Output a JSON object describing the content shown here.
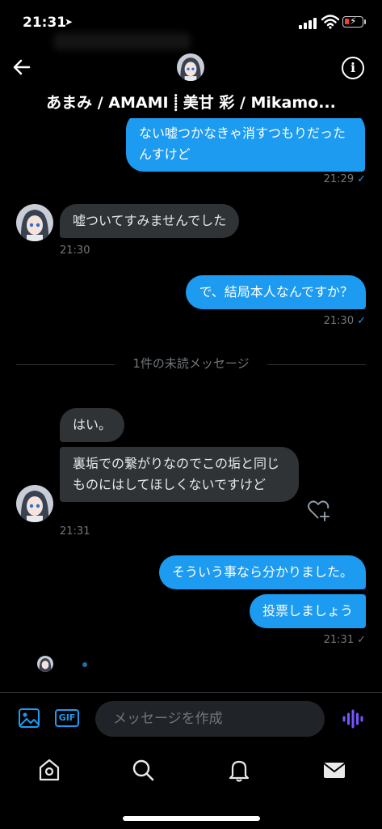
{
  "status_bar": {
    "time": "21:31"
  },
  "header": {
    "name": "あまみ / AMAMI ⸽ 美甘 彩 / Mikamo..."
  },
  "messages": {
    "m1": {
      "text": "ない嘘つかなきゃ消すつもりだったんすけど",
      "time": "21:29"
    },
    "m2": {
      "text": "嘘ついてすみませんでした",
      "time": "21:30"
    },
    "m3": {
      "text": "で、結局本人なんですか？",
      "time": "21:30"
    },
    "m4": {
      "text": "はい。"
    },
    "m5": {
      "text": "裏垢での繋がりなのでこの垢と同じものにはしてほしくないですけど",
      "time": "21:31"
    },
    "m6": {
      "text": "そういう事なら分かりました。"
    },
    "m7": {
      "text": "投票しましょう",
      "time": "21:31"
    }
  },
  "divider": {
    "text": "1件の未読メッセージ"
  },
  "composer": {
    "placeholder": "メッセージを作成",
    "gif_label": "GIF"
  },
  "icons": {
    "back": "arrow-left-icon",
    "info": "info-icon",
    "media": "image-icon",
    "voice": "voice-wave-icon",
    "home": "home-icon",
    "search": "search-icon",
    "notifications": "bell-icon",
    "messages": "mail-icon",
    "heart": "heart-plus-icon"
  },
  "colors": {
    "accent": "#1d9bf0",
    "incoming_bubble": "#2f3336",
    "voice": "#7856ff",
    "background": "#000000"
  }
}
